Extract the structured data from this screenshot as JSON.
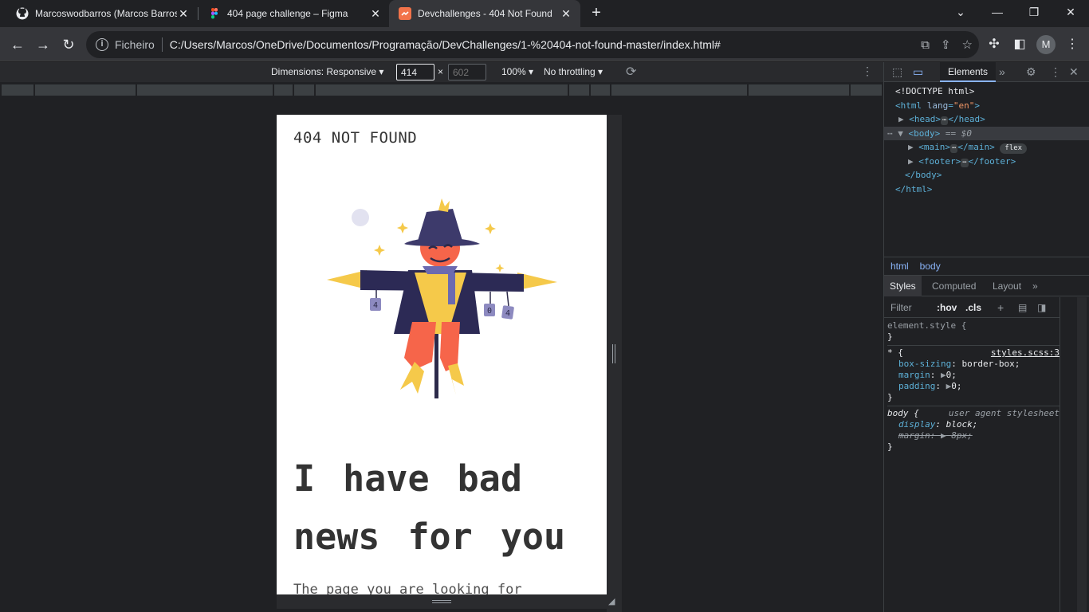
{
  "tabs": [
    {
      "title": "Marcoswodbarros (Marcos Barros)",
      "icon": "github-icon",
      "active": false
    },
    {
      "title": "404 page challenge – Figma",
      "icon": "figma-icon",
      "active": false
    },
    {
      "title": "Devchallenges - 404 Not Found",
      "icon": "devchallenges-icon",
      "active": true
    }
  ],
  "address": {
    "scheme_label": "Ficheiro",
    "url": "C:/Users/Marcos/OneDrive/Documentos/Programação/DevChallenges/1-%20404-not-found-master/index.html#"
  },
  "user_avatar_letter": "M",
  "device_toolbar": {
    "dimensions_label": "Dimensions: Responsive",
    "width": "414",
    "height": "602",
    "times": "×",
    "zoom": "100%",
    "throttling": "No throttling"
  },
  "page": {
    "brand": "404 NOT FOUND",
    "headline": "I have bad news for you",
    "paragraph": "The page you are looking for"
  },
  "devtools": {
    "tab_label": "Elements",
    "dom": {
      "doctype": "<!DOCTYPE html>",
      "html_open": "<html",
      "lang_attr": "lang",
      "lang_val": "\"en\"",
      "head_open": "<head>",
      "head_close": "</head>",
      "body_open": "<body>",
      "body_eq": "== $0",
      "main_open": "<main>",
      "main_close": "</main>",
      "flex_badge": "flex",
      "footer_open": "<footer>",
      "footer_close": "</footer>",
      "body_close": "</body>",
      "html_close": "</html>",
      "ellipsis": "⋯"
    },
    "breadcrumbs": [
      "html",
      "body"
    ],
    "subtabs": [
      "Styles",
      "Computed",
      "Layout"
    ],
    "filter": {
      "placeholder": "Filter",
      "hov": ":hov",
      "cls": ".cls"
    },
    "styles": {
      "element_style": "element.style {",
      "close_brace": "}",
      "universal_selector": "* {",
      "universal_source": "styles.scss:3",
      "prop_box_sizing": "box-sizing",
      "val_box_sizing": "border-box;",
      "prop_margin": "margin",
      "val_margin": "0;",
      "prop_padding": "padding",
      "val_padding": "0;",
      "body_selector": "body {",
      "ua_label": "user agent stylesheet",
      "prop_display": "display",
      "val_display": "block;",
      "prop_margin_ua": "margin",
      "val_margin_ua": "8px;"
    }
  },
  "colors": {
    "accent_blue": "#8ab4f8",
    "scarecrow_hat": "#3d3a6b",
    "scarecrow_face": "#f6654a",
    "straw": "#f5c94a"
  }
}
